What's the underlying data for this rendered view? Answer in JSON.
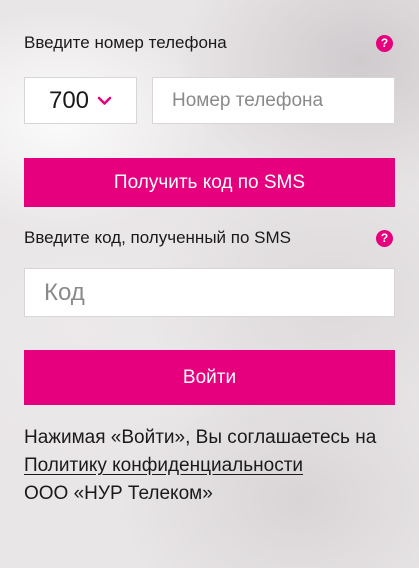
{
  "phone_section": {
    "label": "Введите номер телефона",
    "help_icon": "question-icon",
    "country_code": "700",
    "phone_placeholder": "Номер телефона",
    "phone_value": ""
  },
  "sms_button": {
    "label": "Получить код по SMS"
  },
  "code_section": {
    "label": "Введите код, полученный по SMS",
    "help_icon": "question-icon",
    "code_placeholder": "Код",
    "code_value": ""
  },
  "login_button": {
    "label": "Войти"
  },
  "agreement": {
    "text_before": "Нажимая «Войти», Вы соглашаетесь на ",
    "link_text": "Политику конфиденциальности",
    "text_after": "ООО «НУР Телеком»"
  },
  "colors": {
    "accent": "#e6007e",
    "text": "#1a1a1a",
    "placeholder": "#8a8a8a",
    "input_background": "#ffffff"
  }
}
